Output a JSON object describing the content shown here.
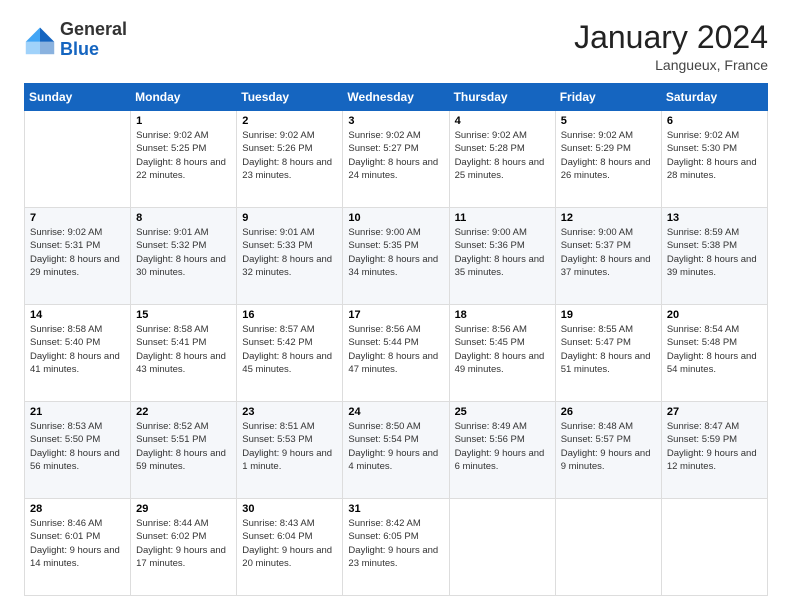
{
  "logo": {
    "general": "General",
    "blue": "Blue"
  },
  "header": {
    "month": "January 2024",
    "location": "Langueux, France"
  },
  "weekdays": [
    "Sunday",
    "Monday",
    "Tuesday",
    "Wednesday",
    "Thursday",
    "Friday",
    "Saturday"
  ],
  "weeks": [
    [
      {
        "day": "",
        "sunrise": "",
        "sunset": "",
        "daylight": ""
      },
      {
        "day": "1",
        "sunrise": "9:02 AM",
        "sunset": "5:25 PM",
        "daylight": "8 hours and 22 minutes."
      },
      {
        "day": "2",
        "sunrise": "9:02 AM",
        "sunset": "5:26 PM",
        "daylight": "8 hours and 23 minutes."
      },
      {
        "day": "3",
        "sunrise": "9:02 AM",
        "sunset": "5:27 PM",
        "daylight": "8 hours and 24 minutes."
      },
      {
        "day": "4",
        "sunrise": "9:02 AM",
        "sunset": "5:28 PM",
        "daylight": "8 hours and 25 minutes."
      },
      {
        "day": "5",
        "sunrise": "9:02 AM",
        "sunset": "5:29 PM",
        "daylight": "8 hours and 26 minutes."
      },
      {
        "day": "6",
        "sunrise": "9:02 AM",
        "sunset": "5:30 PM",
        "daylight": "8 hours and 28 minutes."
      }
    ],
    [
      {
        "day": "7",
        "sunrise": "9:02 AM",
        "sunset": "5:31 PM",
        "daylight": "8 hours and 29 minutes."
      },
      {
        "day": "8",
        "sunrise": "9:01 AM",
        "sunset": "5:32 PM",
        "daylight": "8 hours and 30 minutes."
      },
      {
        "day": "9",
        "sunrise": "9:01 AM",
        "sunset": "5:33 PM",
        "daylight": "8 hours and 32 minutes."
      },
      {
        "day": "10",
        "sunrise": "9:00 AM",
        "sunset": "5:35 PM",
        "daylight": "8 hours and 34 minutes."
      },
      {
        "day": "11",
        "sunrise": "9:00 AM",
        "sunset": "5:36 PM",
        "daylight": "8 hours and 35 minutes."
      },
      {
        "day": "12",
        "sunrise": "9:00 AM",
        "sunset": "5:37 PM",
        "daylight": "8 hours and 37 minutes."
      },
      {
        "day": "13",
        "sunrise": "8:59 AM",
        "sunset": "5:38 PM",
        "daylight": "8 hours and 39 minutes."
      }
    ],
    [
      {
        "day": "14",
        "sunrise": "8:58 AM",
        "sunset": "5:40 PM",
        "daylight": "8 hours and 41 minutes."
      },
      {
        "day": "15",
        "sunrise": "8:58 AM",
        "sunset": "5:41 PM",
        "daylight": "8 hours and 43 minutes."
      },
      {
        "day": "16",
        "sunrise": "8:57 AM",
        "sunset": "5:42 PM",
        "daylight": "8 hours and 45 minutes."
      },
      {
        "day": "17",
        "sunrise": "8:56 AM",
        "sunset": "5:44 PM",
        "daylight": "8 hours and 47 minutes."
      },
      {
        "day": "18",
        "sunrise": "8:56 AM",
        "sunset": "5:45 PM",
        "daylight": "8 hours and 49 minutes."
      },
      {
        "day": "19",
        "sunrise": "8:55 AM",
        "sunset": "5:47 PM",
        "daylight": "8 hours and 51 minutes."
      },
      {
        "day": "20",
        "sunrise": "8:54 AM",
        "sunset": "5:48 PM",
        "daylight": "8 hours and 54 minutes."
      }
    ],
    [
      {
        "day": "21",
        "sunrise": "8:53 AM",
        "sunset": "5:50 PM",
        "daylight": "8 hours and 56 minutes."
      },
      {
        "day": "22",
        "sunrise": "8:52 AM",
        "sunset": "5:51 PM",
        "daylight": "8 hours and 59 minutes."
      },
      {
        "day": "23",
        "sunrise": "8:51 AM",
        "sunset": "5:53 PM",
        "daylight": "9 hours and 1 minute."
      },
      {
        "day": "24",
        "sunrise": "8:50 AM",
        "sunset": "5:54 PM",
        "daylight": "9 hours and 4 minutes."
      },
      {
        "day": "25",
        "sunrise": "8:49 AM",
        "sunset": "5:56 PM",
        "daylight": "9 hours and 6 minutes."
      },
      {
        "day": "26",
        "sunrise": "8:48 AM",
        "sunset": "5:57 PM",
        "daylight": "9 hours and 9 minutes."
      },
      {
        "day": "27",
        "sunrise": "8:47 AM",
        "sunset": "5:59 PM",
        "daylight": "9 hours and 12 minutes."
      }
    ],
    [
      {
        "day": "28",
        "sunrise": "8:46 AM",
        "sunset": "6:01 PM",
        "daylight": "9 hours and 14 minutes."
      },
      {
        "day": "29",
        "sunrise": "8:44 AM",
        "sunset": "6:02 PM",
        "daylight": "9 hours and 17 minutes."
      },
      {
        "day": "30",
        "sunrise": "8:43 AM",
        "sunset": "6:04 PM",
        "daylight": "9 hours and 20 minutes."
      },
      {
        "day": "31",
        "sunrise": "8:42 AM",
        "sunset": "6:05 PM",
        "daylight": "9 hours and 23 minutes."
      },
      {
        "day": "",
        "sunrise": "",
        "sunset": "",
        "daylight": ""
      },
      {
        "day": "",
        "sunrise": "",
        "sunset": "",
        "daylight": ""
      },
      {
        "day": "",
        "sunrise": "",
        "sunset": "",
        "daylight": ""
      }
    ]
  ],
  "labels": {
    "sunrise": "Sunrise:",
    "sunset": "Sunset:",
    "daylight": "Daylight:"
  }
}
